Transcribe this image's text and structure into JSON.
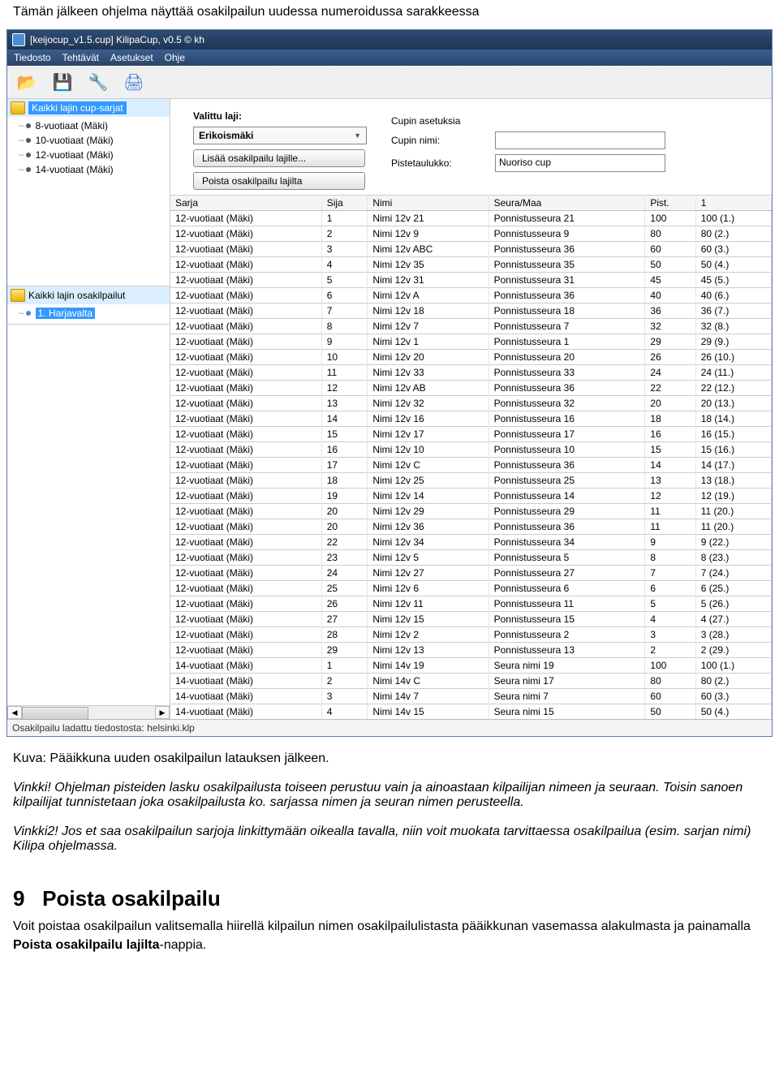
{
  "doc": {
    "intro_line": "Tämän jälkeen ohjelma näyttää osakilpailun uudessa numeroidussa sarakkeessa",
    "caption": "Kuva: Pääikkuna uuden osakilpailun latauksen jälkeen.",
    "hint1_label": "Vinkki!",
    "hint1_text": " Ohjelman pisteiden lasku osakilpailusta toiseen perustuu vain ja ainoastaan kilpailijan nimeen ja seuraan. Toisin sanoen kilpailijat tunnistetaan joka osakilpailusta ko. sarjassa nimen ja seuran nimen perusteella.",
    "hint2_label": "Vinkki2!",
    "hint2_text": " Jos et saa osakilpailun sarjoja linkittymään oikealla tavalla, niin voit muokata tarvittaessa osakilpailua (esim. sarjan nimi) Kilipa ohjelmassa.",
    "h9_number": "9",
    "h9_title": "Poista osakilpailu",
    "final_para_a": "Voit poistaa osakilpailun valitsemalla hiirellä kilpailun nimen osakilpailulistasta pääikkunan vasemassa alakulmasta ja painamalla ",
    "final_para_bold": "Poista osakilpailu lajilta",
    "final_para_b": "-nappia."
  },
  "window": {
    "title": "[keijocup_v1.5.cup] KilipaCup, v0.5 © kh",
    "menus": [
      "Tiedosto",
      "Tehtävät",
      "Asetukset",
      "Ohje"
    ]
  },
  "left": {
    "tree1_head": "Kaikki lajin cup-sarjat",
    "tree1_items": [
      "8-vuotiaat (Mäki)",
      "10-vuotiaat (Mäki)",
      "12-vuotiaat (Mäki)",
      "14-vuotiaat (Mäki)"
    ],
    "tree2_head": "Kaikki lajin osakilpailut",
    "tree2_items": [
      "1. Harjavalta"
    ]
  },
  "params": {
    "valittu_label": "Valittu laji:",
    "valittu_value": "Erikoismäki",
    "btn_add": "Lisää osakilpailu lajille...",
    "btn_remove": "Poista osakilpailu lajilta",
    "cup_asetuksia": "Cupin asetuksia",
    "cup_nimi_label": "Cupin nimi:",
    "cup_nimi_value": "",
    "pistetaulukko_label": "Pistetaulukko:",
    "pistetaulukko_value": "Nuoriso cup"
  },
  "table": {
    "headers": [
      "Sarja",
      "Sija",
      "Nimi",
      "Seura/Maa",
      "Pist.",
      "1"
    ],
    "rows": [
      [
        "12-vuotiaat (Mäki)",
        "1",
        "Nimi 12v 21",
        "Ponnistusseura 21",
        "100",
        "100 (1.)"
      ],
      [
        "12-vuotiaat (Mäki)",
        "2",
        "Nimi 12v 9",
        "Ponnistusseura 9",
        "80",
        "80 (2.)"
      ],
      [
        "12-vuotiaat (Mäki)",
        "3",
        "Nimi 12v ABC",
        "Ponnistusseura 36",
        "60",
        "60 (3.)"
      ],
      [
        "12-vuotiaat (Mäki)",
        "4",
        "Nimi 12v 35",
        "Ponnistusseura 35",
        "50",
        "50 (4.)"
      ],
      [
        "12-vuotiaat (Mäki)",
        "5",
        "Nimi 12v 31",
        "Ponnistusseura 31",
        "45",
        "45 (5.)"
      ],
      [
        "12-vuotiaat (Mäki)",
        "6",
        "Nimi 12v A",
        "Ponnistusseura 36",
        "40",
        "40 (6.)"
      ],
      [
        "12-vuotiaat (Mäki)",
        "7",
        "Nimi 12v 18",
        "Ponnistusseura 18",
        "36",
        "36 (7.)"
      ],
      [
        "12-vuotiaat (Mäki)",
        "8",
        "Nimi 12v 7",
        "Ponnistusseura 7",
        "32",
        "32 (8.)"
      ],
      [
        "12-vuotiaat (Mäki)",
        "9",
        "Nimi 12v 1",
        "Ponnistusseura 1",
        "29",
        "29 (9.)"
      ],
      [
        "12-vuotiaat (Mäki)",
        "10",
        "Nimi 12v 20",
        "Ponnistusseura 20",
        "26",
        "26 (10.)"
      ],
      [
        "12-vuotiaat (Mäki)",
        "11",
        "Nimi 12v 33",
        "Ponnistusseura 33",
        "24",
        "24 (11.)"
      ],
      [
        "12-vuotiaat (Mäki)",
        "12",
        "Nimi 12v AB",
        "Ponnistusseura 36",
        "22",
        "22 (12.)"
      ],
      [
        "12-vuotiaat (Mäki)",
        "13",
        "Nimi 12v 32",
        "Ponnistusseura 32",
        "20",
        "20 (13.)"
      ],
      [
        "12-vuotiaat (Mäki)",
        "14",
        "Nimi 12v 16",
        "Ponnistusseura 16",
        "18",
        "18 (14.)"
      ],
      [
        "12-vuotiaat (Mäki)",
        "15",
        "Nimi 12v 17",
        "Ponnistusseura 17",
        "16",
        "16 (15.)"
      ],
      [
        "12-vuotiaat (Mäki)",
        "16",
        "Nimi 12v 10",
        "Ponnistusseura 10",
        "15",
        "15 (16.)"
      ],
      [
        "12-vuotiaat (Mäki)",
        "17",
        "Nimi 12v C",
        "Ponnistusseura 36",
        "14",
        "14 (17.)"
      ],
      [
        "12-vuotiaat (Mäki)",
        "18",
        "Nimi 12v 25",
        "Ponnistusseura 25",
        "13",
        "13 (18.)"
      ],
      [
        "12-vuotiaat (Mäki)",
        "19",
        "Nimi 12v 14",
        "Ponnistusseura 14",
        "12",
        "12 (19.)"
      ],
      [
        "12-vuotiaat (Mäki)",
        "20",
        "Nimi 12v 29",
        "Ponnistusseura 29",
        "11",
        "11 (20.)"
      ],
      [
        "12-vuotiaat (Mäki)",
        "20",
        "Nimi 12v 36",
        "Ponnistusseura 36",
        "11",
        "11 (20.)"
      ],
      [
        "12-vuotiaat (Mäki)",
        "22",
        "Nimi 12v 34",
        "Ponnistusseura 34",
        "9",
        "9 (22.)"
      ],
      [
        "12-vuotiaat (Mäki)",
        "23",
        "Nimi 12v 5",
        "Ponnistusseura 5",
        "8",
        "8 (23.)"
      ],
      [
        "12-vuotiaat (Mäki)",
        "24",
        "Nimi 12v 27",
        "Ponnistusseura 27",
        "7",
        "7 (24.)"
      ],
      [
        "12-vuotiaat (Mäki)",
        "25",
        "Nimi 12v 6",
        "Ponnistusseura 6",
        "6",
        "6 (25.)"
      ],
      [
        "12-vuotiaat (Mäki)",
        "26",
        "Nimi 12v 11",
        "Ponnistusseura 11",
        "5",
        "5 (26.)"
      ],
      [
        "12-vuotiaat (Mäki)",
        "27",
        "Nimi 12v 15",
        "Ponnistusseura 15",
        "4",
        "4 (27.)"
      ],
      [
        "12-vuotiaat (Mäki)",
        "28",
        "Nimi 12v 2",
        "Ponnistusseura 2",
        "3",
        "3 (28.)"
      ],
      [
        "12-vuotiaat (Mäki)",
        "29",
        "Nimi 12v 13",
        "Ponnistusseura 13",
        "2",
        "2 (29.)"
      ],
      [
        "14-vuotiaat (Mäki)",
        "1",
        "Nimi 14v 19",
        "Seura nimi 19",
        "100",
        "100 (1.)"
      ],
      [
        "14-vuotiaat (Mäki)",
        "2",
        "Nimi 14v C",
        "Seura nimi 17",
        "80",
        "80 (2.)"
      ],
      [
        "14-vuotiaat (Mäki)",
        "3",
        "Nimi 14v 7",
        "Seura nimi 7",
        "60",
        "60 (3.)"
      ],
      [
        "14-vuotiaat (Mäki)",
        "4",
        "Nimi 14v 15",
        "Seura nimi 15",
        "50",
        "50 (4.)"
      ]
    ]
  },
  "status": "Osakilpailu ladattu tiedostosta: helsinki.klp"
}
